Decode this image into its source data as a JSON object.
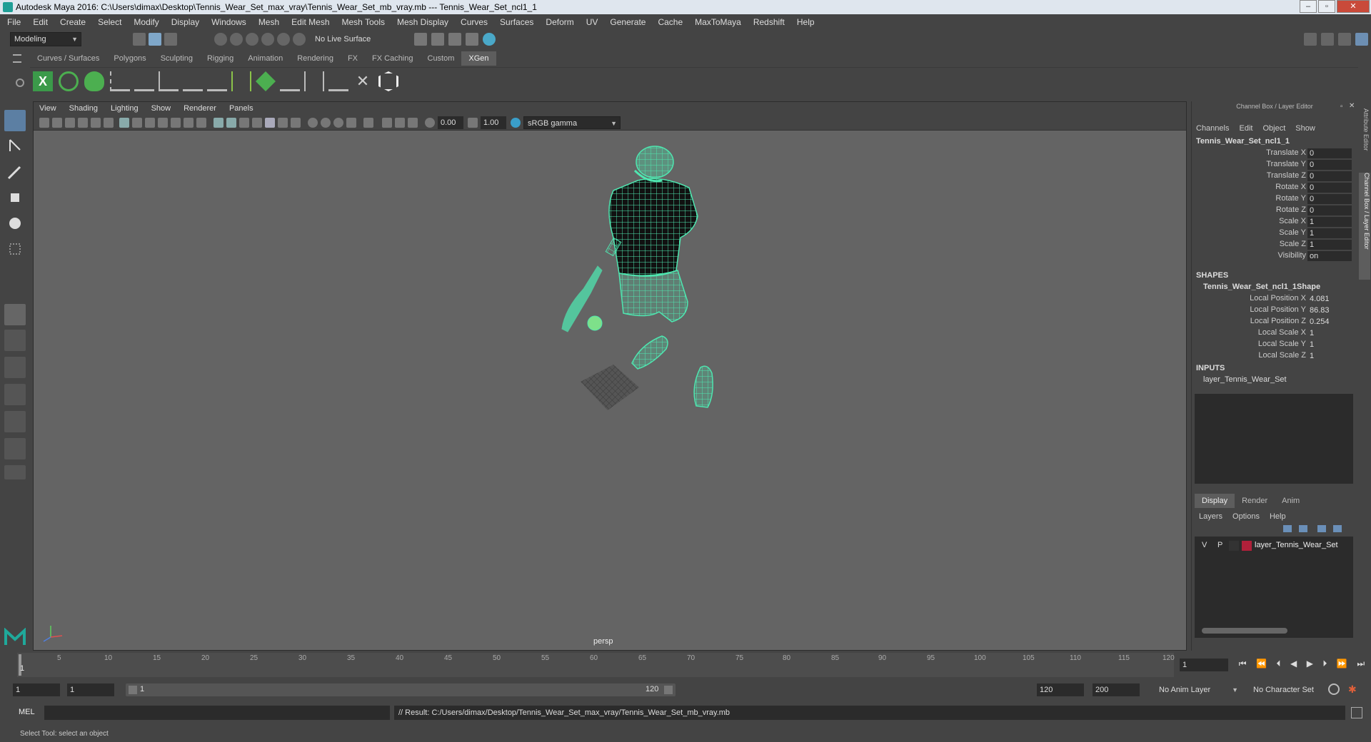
{
  "window": {
    "title": "Autodesk Maya 2016: C:\\Users\\dimax\\Desktop\\Tennis_Wear_Set_max_vray\\Tennis_Wear_Set_mb_vray.mb   ---   Tennis_Wear_Set_ncl1_1"
  },
  "menubar": [
    "File",
    "Edit",
    "Create",
    "Select",
    "Modify",
    "Display",
    "Windows",
    "Mesh",
    "Edit Mesh",
    "Mesh Tools",
    "Mesh Display",
    "Curves",
    "Surfaces",
    "Deform",
    "UV",
    "Generate",
    "Cache",
    "MaxToMaya",
    "Redshift",
    "Help"
  ],
  "statusline": {
    "mode": "Modeling",
    "live_surface": "No Live Surface"
  },
  "shelf": {
    "tabs": [
      "Curves / Surfaces",
      "Polygons",
      "Sculpting",
      "Rigging",
      "Animation",
      "Rendering",
      "FX",
      "FX Caching",
      "Custom",
      "XGen"
    ],
    "active_tab": "XGen"
  },
  "viewport": {
    "menu": [
      "View",
      "Shading",
      "Lighting",
      "Show",
      "Renderer",
      "Panels"
    ],
    "exposure": "0.00",
    "gamma": "1.00",
    "color_space": "sRGB gamma",
    "camera_label": "persp"
  },
  "channel_box": {
    "title": "Channel Box / Layer Editor",
    "menu": [
      "Channels",
      "Edit",
      "Object",
      "Show"
    ],
    "object_name": "Tennis_Wear_Set_ncl1_1",
    "channels": [
      {
        "label": "Translate X",
        "value": "0"
      },
      {
        "label": "Translate Y",
        "value": "0"
      },
      {
        "label": "Translate Z",
        "value": "0"
      },
      {
        "label": "Rotate X",
        "value": "0"
      },
      {
        "label": "Rotate Y",
        "value": "0"
      },
      {
        "label": "Rotate Z",
        "value": "0"
      },
      {
        "label": "Scale X",
        "value": "1"
      },
      {
        "label": "Scale Y",
        "value": "1"
      },
      {
        "label": "Scale Z",
        "value": "1"
      },
      {
        "label": "Visibility",
        "value": "on"
      }
    ],
    "shapes_header": "SHAPES",
    "shape_name": "Tennis_Wear_Set_ncl1_1Shape",
    "shape_channels": [
      {
        "label": "Local Position X",
        "value": "4.081"
      },
      {
        "label": "Local Position Y",
        "value": "86.83"
      },
      {
        "label": "Local Position Z",
        "value": "0.254"
      },
      {
        "label": "Local Scale X",
        "value": "1"
      },
      {
        "label": "Local Scale Y",
        "value": "1"
      },
      {
        "label": "Local Scale Z",
        "value": "1"
      }
    ],
    "inputs_header": "INPUTS",
    "input_name": "layer_Tennis_Wear_Set"
  },
  "layer_editor": {
    "tabs": [
      "Display",
      "Render",
      "Anim"
    ],
    "active_tab": "Display",
    "menu": [
      "Layers",
      "Options",
      "Help"
    ],
    "layer": {
      "v": "V",
      "p": "P",
      "name": "layer_Tennis_Wear_Set",
      "color": "#b0203a"
    }
  },
  "side_tabs": [
    "Attribute Editor",
    "Channel Box / Layer Editor"
  ],
  "timeline": {
    "ticks": [
      "1",
      "5",
      "10",
      "15",
      "20",
      "25",
      "30",
      "35",
      "40",
      "45",
      "50",
      "55",
      "60",
      "65",
      "70",
      "75",
      "80",
      "85",
      "90",
      "95",
      "100",
      "105",
      "110",
      "115",
      "120"
    ],
    "current_frame": "1"
  },
  "range": {
    "start": "1",
    "anim_start": "1",
    "slider_start": "1",
    "slider_end": "120",
    "end": "120",
    "anim_end": "200",
    "anim_layer": "No Anim Layer",
    "character_set": "No Character Set"
  },
  "command": {
    "lang": "MEL",
    "result": "// Result: C:/Users/dimax/Desktop/Tennis_Wear_Set_max_vray/Tennis_Wear_Set_mb_vray.mb"
  },
  "help_line": "Select Tool: select an object",
  "colors": {
    "wire": "#4fe6b0",
    "ui_bg": "#444444",
    "viewport_bg": "#646464"
  }
}
